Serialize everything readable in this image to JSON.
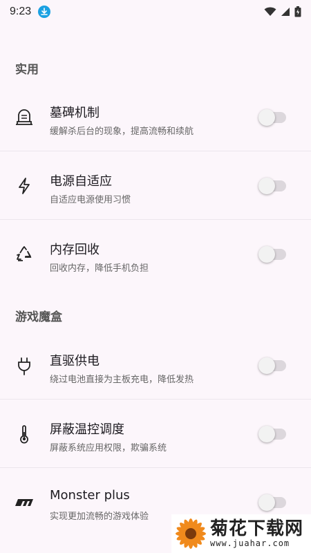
{
  "status_bar": {
    "time": "9:23",
    "icons": [
      "download-icon",
      "wifi-icon",
      "signal-icon",
      "battery-icon"
    ]
  },
  "sections": [
    {
      "title": "实用"
    },
    {
      "title": "游戏魔盒"
    }
  ],
  "rows": [
    {
      "title": "墓碑机制",
      "subtitle": "缓解杀后台的现象，提高流畅和续航",
      "icon": "tombstone-icon",
      "enabled": false
    },
    {
      "title": "电源自适应",
      "subtitle": "自适应电源使用习惯",
      "icon": "lightning-icon",
      "enabled": false
    },
    {
      "title": "内存回收",
      "subtitle": "回收内存，降低手机负担",
      "icon": "recycle-icon",
      "enabled": false
    },
    {
      "title": "直驱供电",
      "subtitle": "绕过电池直接为主板充电，降低发热",
      "icon": "plug-icon",
      "enabled": false
    },
    {
      "title": "屏蔽温控调度",
      "subtitle": "屏蔽系统应用权限，欺骗系统",
      "icon": "thermometer-icon",
      "enabled": false
    },
    {
      "title": "Monster plus",
      "subtitle": "实现更加流畅的游戏体验",
      "icon": "monster-logo-icon",
      "enabled": false
    }
  ],
  "watermark": {
    "title": "菊花下载网",
    "url": "www.juahar.com"
  },
  "colors": {
    "background": "#fcf6fb",
    "toggle_track_off": "#dcd7dc",
    "download_badge": "#1ba1e2"
  }
}
